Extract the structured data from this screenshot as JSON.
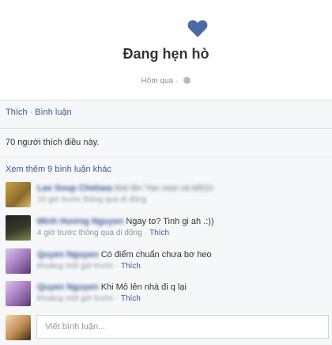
{
  "header": {
    "title": "Đang hẹn hò",
    "time": "Hôm qua",
    "heart_color": "#4a6aa5"
  },
  "actions": {
    "like": "Thích",
    "comment": "Bình luận"
  },
  "likes_summary": "70 người thích điều này.",
  "more_comments": "Xem thêm 9 bình luận khác",
  "comments": [
    {
      "name": "Lee Soup Chelsea",
      "text": "Mai lên Yan new và kết10",
      "time": "10 giờ trước thông qua di động",
      "like": "Thích",
      "text_blurred": true
    },
    {
      "name": "Minh Hương Nguyen",
      "text": "Ngay to? Tinh gi ah .:))",
      "time": "4 giờ trước thông qua di động",
      "like": "Thích",
      "text_blurred": false
    },
    {
      "name": "Quyen Nguyen",
      "text": "Có điểm chuẩn chưa bơ heo",
      "time": "khoảng một giờ trước",
      "like": "Thích",
      "text_blurred": false
    },
    {
      "name": "Quyen Nguyen",
      "text": "Khi Mô lên nhà đi q lại",
      "time": "khoảng một giờ trước",
      "like": "Thích",
      "text_blurred": false
    }
  ],
  "composer": {
    "placeholder": "Viết bình luận..."
  }
}
